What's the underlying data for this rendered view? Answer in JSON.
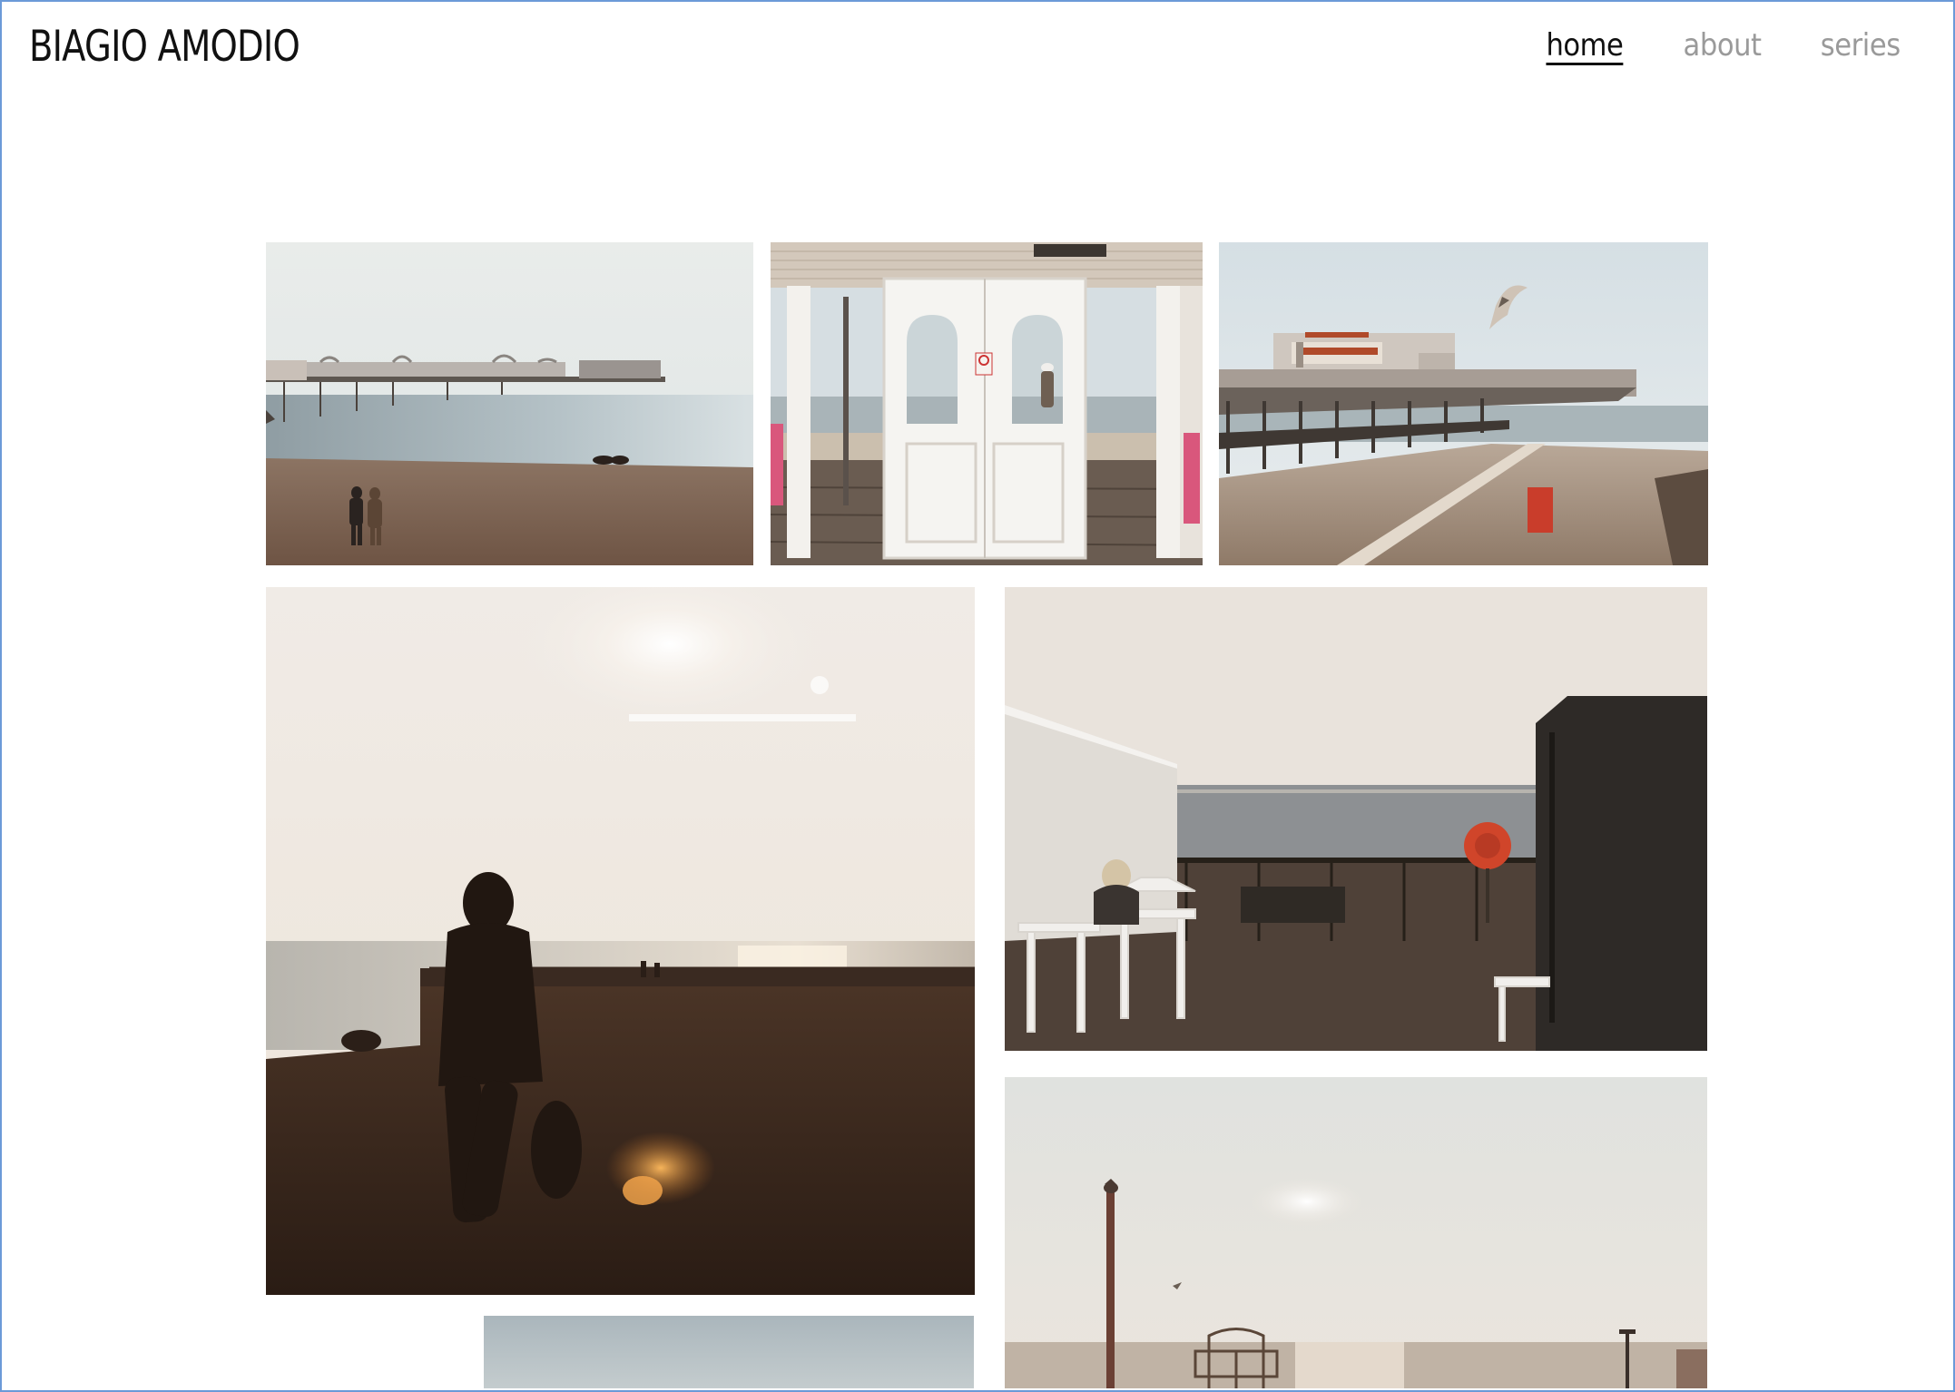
{
  "site": {
    "title": "BIAGIO AMODIO"
  },
  "nav": {
    "items": [
      {
        "label": "home",
        "active": true
      },
      {
        "label": "about",
        "active": false
      },
      {
        "label": "series",
        "active": false
      }
    ]
  },
  "photos": [
    "photo-palace-pier-beach",
    "photo-pier-doors",
    "photo-palace-pier-seagull",
    "photo-hooded-walker",
    "photo-seafront-cafe",
    "photo-west-pier",
    "photo-bottom-partial"
  ]
}
